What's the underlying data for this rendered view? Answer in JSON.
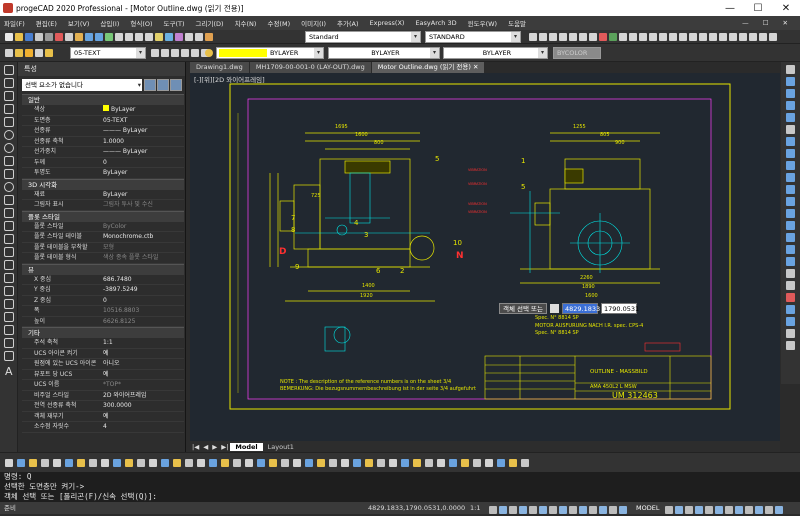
{
  "window": {
    "title": "progeCAD 2020 Professional - [Motor Outline.dwg (읽기 전용)]"
  },
  "menu": [
    "파일(F)",
    "편집(E)",
    "보기(V)",
    "삽입(I)",
    "형식(O)",
    "도구(T)",
    "그리기(D)",
    "치수(N)",
    "수정(M)",
    "이미지(I)",
    "추가(A)",
    "Express(X)",
    "EasyArch 3D",
    "윈도우(W)",
    "도움말"
  ],
  "toolbar2": {
    "style1": "Standard",
    "style2": "STANDARD"
  },
  "toolbar3": {
    "layer": "05-TEXT",
    "color": "BYLAYER",
    "linetype": "BYLAYER",
    "lineweight": "BYLAYER",
    "plotstyle": "BYCOLOR"
  },
  "properties": {
    "title": "특성",
    "selection": "선택 요소가 없습니다",
    "sections": [
      {
        "name": "일반",
        "rows": [
          [
            "색상",
            "ByLayer"
          ],
          [
            "도면층",
            "05-TEXT"
          ],
          [
            "선종류",
            "——— ByLayer"
          ],
          [
            "선종류 축척",
            "1.0000"
          ],
          [
            "선가중치",
            "——— ByLayer"
          ],
          [
            "두께",
            "0"
          ],
          [
            "투명도",
            "ByLayer"
          ]
        ]
      },
      {
        "name": "3D 시각화",
        "rows": [
          [
            "재료",
            "ByLayer"
          ],
          [
            "그림자 표시",
            "그림자 투사 및 수신"
          ]
        ]
      },
      {
        "name": "플롯 스타일",
        "rows": [
          [
            "플롯 스타일",
            "ByColor"
          ],
          [
            "플롯 스타일 테이블",
            "Monochrome.ctb"
          ],
          [
            "플롯 테이블을 부착할",
            "모형"
          ],
          [
            "플롯 테이블 형식",
            "색상 종속 플롯 스타일"
          ]
        ]
      },
      {
        "name": "뷰",
        "rows": [
          [
            "X 중심",
            "686.7480"
          ],
          [
            "Y 중심",
            "-3897.5249"
          ],
          [
            "Z 중심",
            "0"
          ],
          [
            "폭",
            "10516.8803"
          ],
          [
            "높이",
            "6626.8125"
          ]
        ]
      },
      {
        "name": "기타",
        "rows": [
          [
            "주석 축척",
            "1:1"
          ],
          [
            "UCS 아이콘 켜기",
            "예"
          ],
          [
            "원점에 있는 UCS 아이콘",
            "아니오"
          ],
          [
            "뷰포트 당 UCS",
            "예"
          ],
          [
            "UCS 이름",
            "*TOP*"
          ],
          [
            "비주얼 스타일",
            "2D 와이어프레임"
          ],
          [
            "전역 선종류 축척",
            "300.0000"
          ],
          [
            "객체 재부기",
            "예"
          ],
          [
            "소수점 자릿수",
            "4"
          ]
        ]
      }
    ]
  },
  "tabs": [
    "Drawing1.dwg",
    "MH1709-00-001-0 (LAY-OUT).dwg",
    "Motor Outline.dwg (읽기 전용)"
  ],
  "view_label": "[-][위][2D 와이어프레임]",
  "drawing": {
    "labels": {
      "n5a": "5",
      "n4": "4",
      "n7": "7",
      "n3": "3",
      "n6": "6",
      "n2": "2",
      "n1": "1",
      "n8": "8",
      "n9": "9",
      "n10": "10",
      "D": "D",
      "N": "N",
      "n5b": "5"
    },
    "dims": [
      "1695",
      "1600",
      "800",
      "725",
      "1400",
      "1920",
      "1255",
      "805",
      "900",
      "2260",
      "1890",
      "1600"
    ],
    "note": "NOTE : The description of the reference numbers is on the sheet 3/4",
    "note2": "BEMERKUNG: Die bezugsnummernbeschreibung ist in der seite 3/4 aufgefuhrt",
    "spec1": "Spec. N° 8814 SP",
    "spec2": "MOTOR AUSFURUNG NACH I.R. spec. CPS-4",
    "spec3": "Spec. N° 8814 SP",
    "tb_title": "OUTLINE - MASSBILD",
    "tb_code": "UM 312463",
    "tb_type": "AMA 450L2 L MSW"
  },
  "tooltip": {
    "label": "객체 선택 또는",
    "x": "4829.1833",
    "y": "1790.0531"
  },
  "layout_tabs": {
    "model": "Model",
    "layout": "Layout1"
  },
  "command": [
    "명령: Q",
    "선택한 도면층만 켜기->",
    "객체 선택 또는 [폴리곤(F)/신속 선택(Q)]:"
  ],
  "status": {
    "ready": "준비",
    "coords": "4829.1833,1790.0531,0.0000",
    "model": "MODEL",
    "scale": "1:1"
  }
}
